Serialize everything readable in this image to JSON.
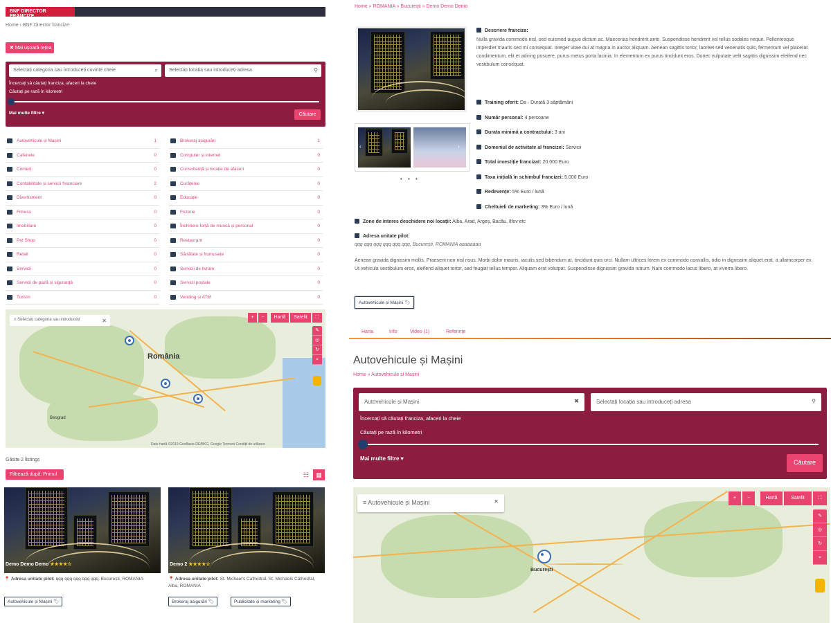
{
  "left_page": {
    "banner": "BNF DIRECTOR FRANCIZE",
    "breadcrumb": "Home › BNF Director francize",
    "show_map_button": "Mai ușoară rețea",
    "search": {
      "category_placeholder": "Selectați categoria sau introduceți cuvinte cheie",
      "location_placeholder": "Selectați locația sau introduceți adresa",
      "hint": "Încercați să căutați franciza, afaceri la cheie",
      "radius_label": "Căutați pe rază în kilometri",
      "more_filters": "Mai multe filtre ▾",
      "submit": "Căutare"
    },
    "categories_left": [
      {
        "label": "Autovehicule și Mașini",
        "count": "1"
      },
      {
        "label": "Cafenele",
        "count": "0"
      },
      {
        "label": "Comerț",
        "count": "0"
      },
      {
        "label": "Contabilitate și servicii financiare",
        "count": "2"
      },
      {
        "label": "Divertisment",
        "count": "0"
      },
      {
        "label": "Fitness",
        "count": "0"
      },
      {
        "label": "Imobiliare",
        "count": "0"
      },
      {
        "label": "Pet Shop",
        "count": "0"
      },
      {
        "label": "Retail",
        "count": "0"
      },
      {
        "label": "Servicii",
        "count": "0"
      },
      {
        "label": "Servicii de pază și siguranță",
        "count": "0"
      },
      {
        "label": "Turism",
        "count": "0"
      }
    ],
    "categories_right": [
      {
        "label": "Brokeraj asigurări",
        "count": "1"
      },
      {
        "label": "Computer și internet",
        "count": "0"
      },
      {
        "label": "Consultanță și locație de afaceri",
        "count": "0"
      },
      {
        "label": "Curățenie",
        "count": "0"
      },
      {
        "label": "Educație",
        "count": "0"
      },
      {
        "label": "Frizerie",
        "count": "0"
      },
      {
        "label": "Închiriere forță de muncă și personal",
        "count": "0"
      },
      {
        "label": "Restaurant",
        "count": "0"
      },
      {
        "label": "Sănătate și frumusețe",
        "count": "0"
      },
      {
        "label": "Servicii de livrare",
        "count": "0"
      },
      {
        "label": "Servicii poștale",
        "count": "0"
      },
      {
        "label": "Vending și ATM",
        "count": "0"
      }
    ],
    "map": {
      "search_placeholder": "Selectați categoria sau introduceți",
      "map_button": "Hartă",
      "satellite_button": "Satelit",
      "country_label": "România",
      "city_label": "Beograd",
      "attribution": "Date hartă ©2019 GeoBasis-DE/BKG, Google  Termeni  Condiții de utilizare"
    },
    "results_text": "Găsite 2 listings",
    "filter_button": "Filtrează după: Primul",
    "cards": [
      {
        "title": "Demo Demo Demo",
        "rating": "★★★★☆",
        "address_label": "Adresa unitate pilot:",
        "address": "qqq qqq qqq qqq qqq, București, ROMANIA",
        "tags": [
          "Autovehicule și Mașini"
        ]
      },
      {
        "title": "Demo 2",
        "rating": "★★★★☆",
        "address_label": "Adresa unitate pilot:",
        "address": "St. Michael's Cathedral, St. Michaels Cathedral, Alba, ROMANIA",
        "tags": [
          "Brokeraj asigurări",
          "Publicitate și marketing"
        ]
      }
    ]
  },
  "detail_page": {
    "breadcrumb": "Home » ROMANIA » București » Demo Demo Demo",
    "description_title": "Descriere franciza:",
    "description": "Nulla gravida commodo nisl, sed euismod augue dictum ac. Maecenas hendrerit ante. Suspendisse hendrerit vel tellus sodales neque. Pellentesque imperdiet mauris sed mi consequat. Integer vitae dui at magna in auctor aliquam. Aenean sagittis tortor, laoreet sed venenatis quis, fermentum vel placerat condimentum, elit et adiring posuere, purus metus porta lacinia. In elementum ex purus tincidunt eros. Donec vulputate velit sagittis dignissim eleifend nec vestibulum consequat.",
    "facts": [
      {
        "label": "Training oferit:",
        "value": "Da - Durată 3 săptămâni"
      },
      {
        "label": "Număr personal:",
        "value": "4 persoane"
      },
      {
        "label": "Durata minimă a contractului:",
        "value": "3 ani"
      },
      {
        "label": "Domeniul de activitate al francizei:",
        "value": "Servicii"
      },
      {
        "label": "Total investiție francizat:",
        "value": "20.000 Euro"
      },
      {
        "label": "Taxa inițială în schimbul francizei:",
        "value": "5.000 Euro"
      },
      {
        "label": "Redevențe:",
        "value": "5% Euro / lună"
      },
      {
        "label": "Cheltuieli de marketing:",
        "value": "3% Euro / lună"
      }
    ],
    "zones_label": "Zone de interes deschidere noi locații:",
    "zones_value": "Alba, Arad, Argeș, Bacău, Ilfov etc",
    "pilot_label": "Adresa unitate pilot:",
    "pilot_value": "qqq qqq qqq qqq qqq qqq, București, ROMANIA aaaaaaaa",
    "long_text": "Aenean gravida dignissim mollis. Praesent non nisl risus. Morbi dolor mauris, iaculis sed bibendum at, tincidunt quis orci. Nullam ultrices lorem ex commodo convallis, odio in dignissim aliquet erat, a ullamcorper ex. Ut vehicula vestibulum eros, eleifend aliquet tortor, sed feugiat tellus tempor. Aliquam erat volutpat. Suspendisse dignissim gravida rutrum. Nam commodo lacus libero, at viverra libero.",
    "category_tag": "Autovehicule și Mașini",
    "tabs": [
      "Harta",
      "Info",
      "Video (1)",
      "Referințe"
    ]
  },
  "category_page": {
    "title": "Autovehicule și Mașini",
    "breadcrumb": "Home » Autovehicule și Mașini",
    "search": {
      "category_value": "Autovehicule și Mașini",
      "location_placeholder": "Selectați locația sau introduceți adresa",
      "hint": "Încercați să căutați franciza, afaceri la cheie",
      "radius_label": "Căutați pe rază în kilometri",
      "more_filters": "Mai multe filtre ▾",
      "submit": "Căutare"
    },
    "map": {
      "search_value": "Autovehicule și Mașini",
      "map_button": "Hartă",
      "satellite_button": "Satelit",
      "city_label": "București"
    }
  }
}
